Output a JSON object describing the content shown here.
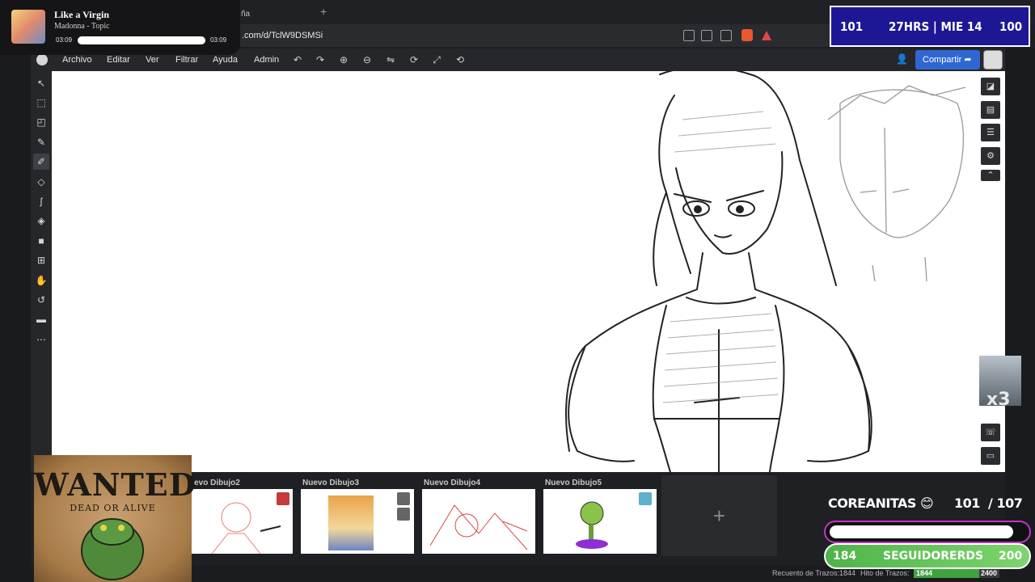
{
  "browser": {
    "tab_label": "ña",
    "url": ".com/d/TclW9DSMSi"
  },
  "music": {
    "title": "Like a Virgin",
    "artist": "Madonna - Topic",
    "time_current": "03:09",
    "time_total": "03:09",
    "progress": 1.0
  },
  "menu": {
    "items": [
      "Archivo",
      "Editar",
      "Ver",
      "Filtrar",
      "Ayuda",
      "Admin"
    ],
    "share_label": "Compartir"
  },
  "stream": {
    "left_value": "101",
    "center": "27HRS | MIE 14",
    "right_value": "100"
  },
  "drawings": [
    {
      "name": "uevo Dibujo2"
    },
    {
      "name": "Nuevo Dibujo3"
    },
    {
      "name": "Nuevo Dibujo4"
    },
    {
      "name": "Nuevo Dibujo5"
    }
  ],
  "add_drawing_label": "+",
  "status": {
    "strokes_label": "Recuento de Trazos:",
    "strokes_value": "1844",
    "milestone_label": "Hito de Trazos:",
    "bar_value": "1844",
    "bar_max": "2400",
    "bar_fraction": 0.768
  },
  "poster": {
    "title": "WANTED",
    "subtitle": "DEAD OR ALIVE"
  },
  "goal": {
    "label": "COREANITAS",
    "current": "101",
    "target": "107",
    "fraction": 0.94
  },
  "followers": {
    "left": "184",
    "label": "SEGUIDORERDS",
    "right": "200"
  },
  "cam_label": "x3",
  "colors": {
    "share": "#2f67d2",
    "stream_box": "#1d1796",
    "goal_border": "#c235c9",
    "followers": "#4fb34a",
    "status_bar": "#3fa43f"
  }
}
